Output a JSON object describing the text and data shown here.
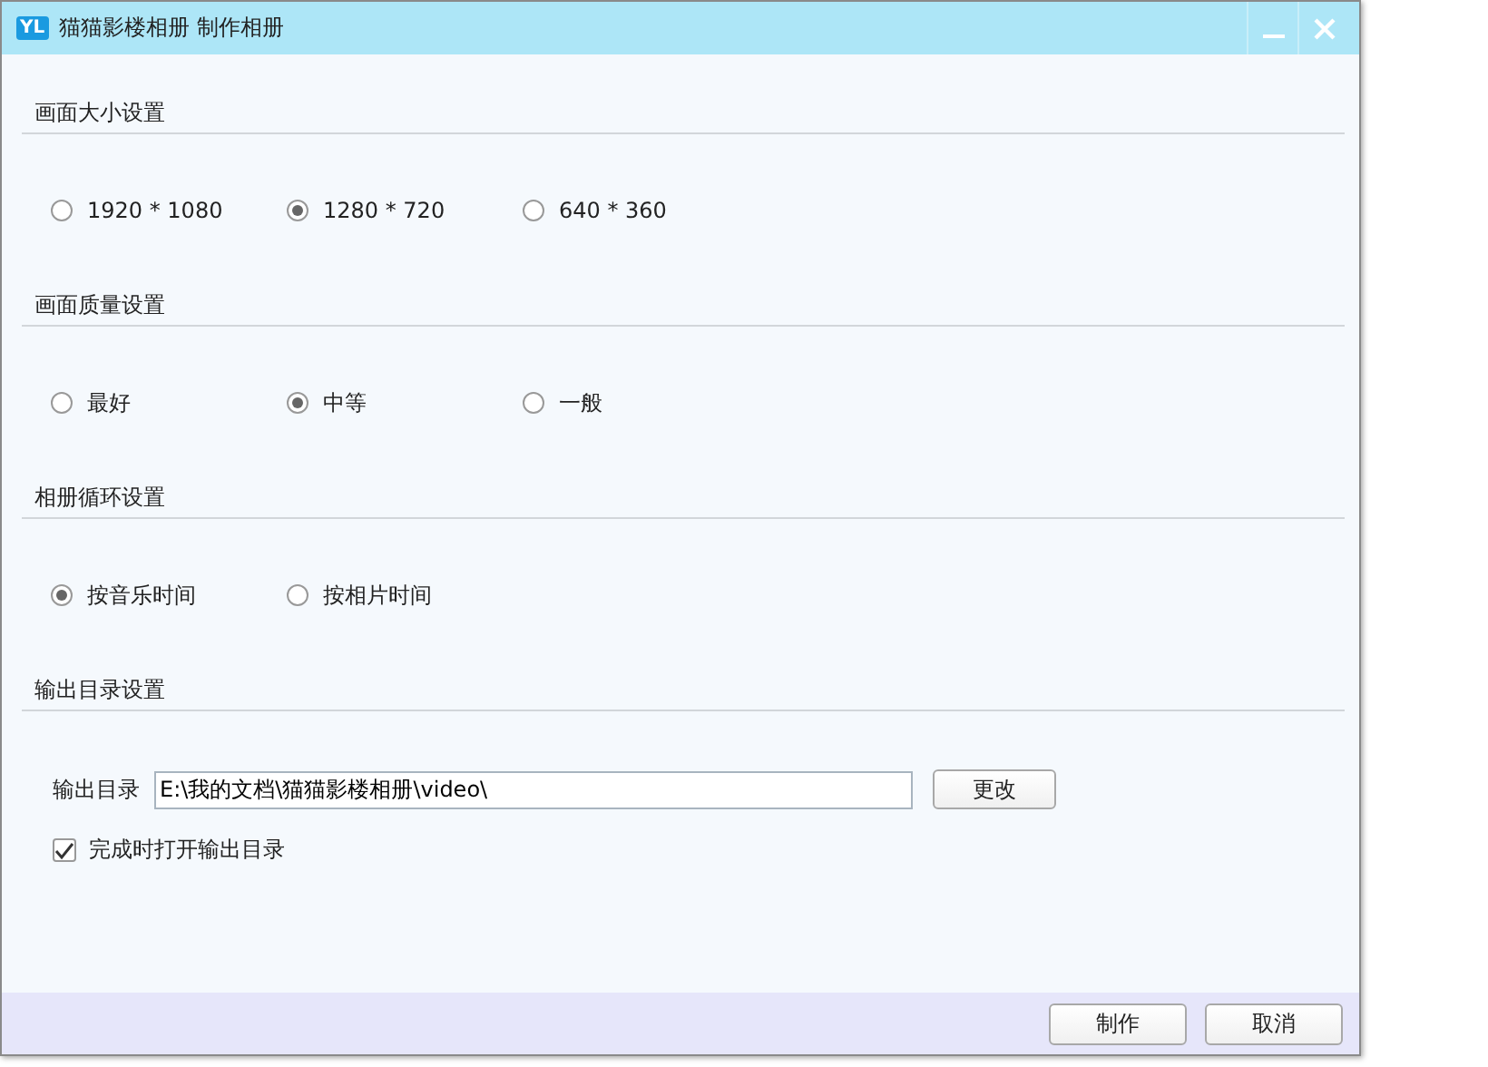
{
  "window": {
    "badge": "YL",
    "title": "猫猫影楼相册 制作相册"
  },
  "sections": [
    {
      "kind": "radio",
      "heading": "画面大小设置",
      "options": [
        {
          "label": "1920 * 1080",
          "selected": false
        },
        {
          "label": "1280 * 720",
          "selected": true
        },
        {
          "label": "640 * 360",
          "selected": false
        }
      ]
    },
    {
      "kind": "radio",
      "heading": "画面质量设置",
      "options": [
        {
          "label": "最好",
          "selected": false
        },
        {
          "label": "中等",
          "selected": true
        },
        {
          "label": "一般",
          "selected": false
        }
      ]
    },
    {
      "kind": "radio",
      "heading": "相册循环设置",
      "options": [
        {
          "label": "按音乐时间",
          "selected": true
        },
        {
          "label": "按相片时间",
          "selected": false
        }
      ]
    },
    {
      "kind": "output",
      "heading": "输出目录设置",
      "label": "输出目录",
      "value": "E:\\我的文档\\猫猫影楼相册\\video\\",
      "button": "更改",
      "checkbox": {
        "label": "完成时打开输出目录",
        "checked": true
      }
    }
  ],
  "buttons": [
    "制作",
    "取消"
  ]
}
